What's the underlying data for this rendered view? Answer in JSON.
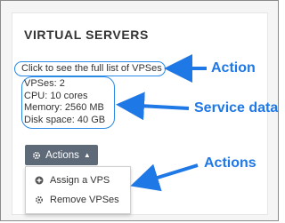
{
  "panel": {
    "title": "VIRTUAL SERVERS",
    "link_text": "Click to see the full list of VPSes"
  },
  "stats": [
    "VPSes: 2",
    "CPU: 10 cores",
    "Memory: 2560 MB",
    "Disk space: 40 GB"
  ],
  "actions_button": {
    "label": "Actions",
    "icon": "gear-icon",
    "caret": "caret-up-icon"
  },
  "menu": {
    "items": [
      {
        "label": "Assign a VPS",
        "icon": "plus-circle-icon"
      },
      {
        "label": "Remove VPSes",
        "icon": "gear-icon"
      }
    ]
  },
  "annotations": {
    "action": "Action",
    "service_data": "Service data",
    "actions": "Actions",
    "color": "#1e78e6"
  },
  "colors": {
    "button_bg": "#5e6a78",
    "highlight": "#2a8ae6"
  }
}
